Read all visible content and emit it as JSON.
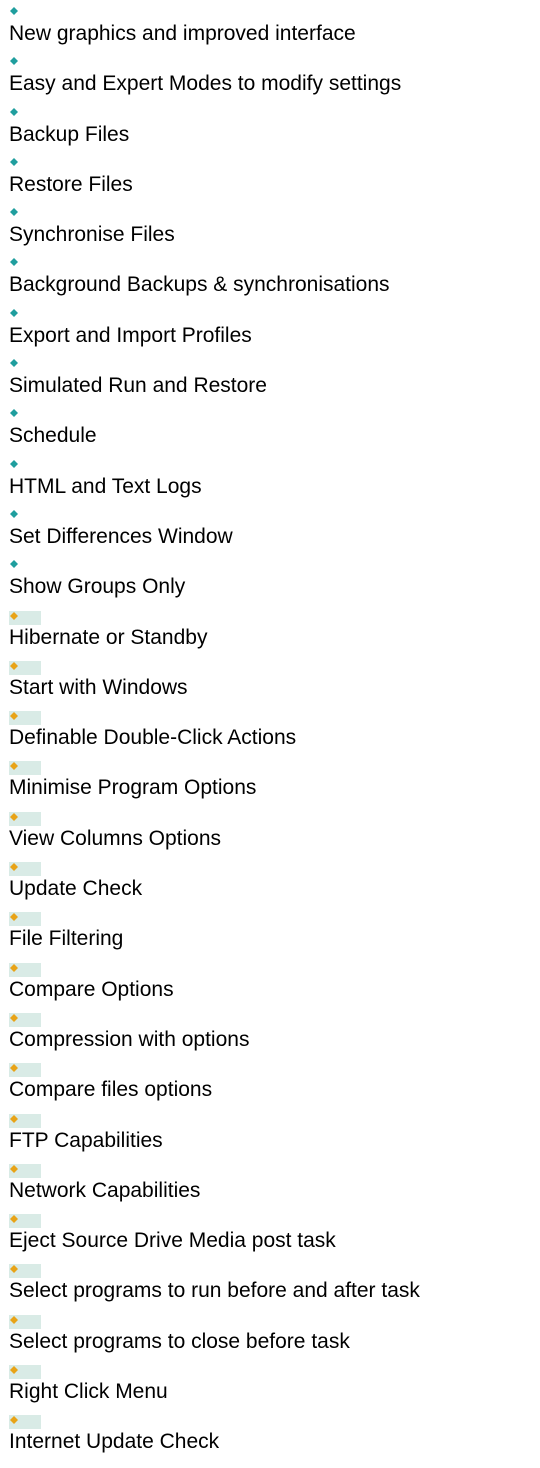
{
  "colors": {
    "teal_bullet": "#1f9e9e",
    "orange_bullet": "#e8a317",
    "bullet_highlight": "#d9ebe6"
  },
  "features": [
    {
      "label": "New graphics and improved interface",
      "bullet": "teal-diamond-icon"
    },
    {
      "label": "Easy and Expert Modes to modify settings",
      "bullet": "teal-diamond-icon"
    },
    {
      "label": "Backup Files",
      "bullet": "teal-diamond-icon"
    },
    {
      "label": "Restore Files",
      "bullet": "teal-diamond-icon"
    },
    {
      "label": "Synchronise Files",
      "bullet": "teal-diamond-icon"
    },
    {
      "label": "Background Backups & synchronisations",
      "bullet": "teal-diamond-icon"
    },
    {
      "label": "Export and Import Profiles",
      "bullet": "teal-diamond-icon"
    },
    {
      "label": "Simulated Run and Restore",
      "bullet": "teal-diamond-icon"
    },
    {
      "label": "Schedule",
      "bullet": "teal-diamond-icon"
    },
    {
      "label": "HTML and Text Logs",
      "bullet": "teal-diamond-icon"
    },
    {
      "label": "Set Differences Window",
      "bullet": "teal-diamond-icon"
    },
    {
      "label": "Show Groups Only",
      "bullet": "teal-diamond-icon"
    },
    {
      "label": "Hibernate or Standby",
      "bullet": "orange-diamond-icon"
    },
    {
      "label": "Start with Windows",
      "bullet": "orange-diamond-icon"
    },
    {
      "label": "Definable Double-Click Actions",
      "bullet": "orange-diamond-icon"
    },
    {
      "label": "Minimise Program Options",
      "bullet": "orange-diamond-icon"
    },
    {
      "label": "View Columns Options",
      "bullet": "orange-diamond-icon"
    },
    {
      "label": "Update Check",
      "bullet": "orange-diamond-icon"
    },
    {
      "label": "File Filtering",
      "bullet": "orange-diamond-icon"
    },
    {
      "label": "Compare Options",
      "bullet": "orange-diamond-icon"
    },
    {
      "label": "Compression with options",
      "bullet": "orange-diamond-icon"
    },
    {
      "label": "Compare files options",
      "bullet": "orange-diamond-icon"
    },
    {
      "label": "FTP Capabilities",
      "bullet": "orange-diamond-icon"
    },
    {
      "label": "Network Capabilities",
      "bullet": "orange-diamond-icon"
    },
    {
      "label": "Eject Source Drive Media post task",
      "bullet": "orange-diamond-icon"
    },
    {
      "label": "Select programs to run before and after task",
      "bullet": "orange-diamond-icon"
    },
    {
      "label": "Select programs to close before task",
      "bullet": "orange-diamond-icon"
    },
    {
      "label": "Right Click Menu",
      "bullet": "orange-diamond-icon"
    },
    {
      "label": "Internet Update Check",
      "bullet": "orange-diamond-icon"
    }
  ]
}
